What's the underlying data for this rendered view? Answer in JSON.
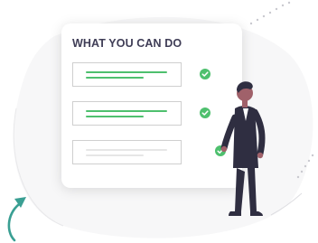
{
  "card": {
    "title": "WHAT YOU CAN DO",
    "items": [
      {
        "state": "checked"
      },
      {
        "state": "checked"
      },
      {
        "state": "pending"
      }
    ]
  },
  "icons": {
    "item_status": "check-icon",
    "accent": "curved-arrow-icon"
  },
  "colors": {
    "accent_green": "#4ec06e",
    "pending_bar": "#e6e6e6",
    "heading_text": "#3f3d56",
    "suit": "#2f2e41",
    "skin": "#a0616a",
    "arrow_teal": "#3a9f93"
  }
}
